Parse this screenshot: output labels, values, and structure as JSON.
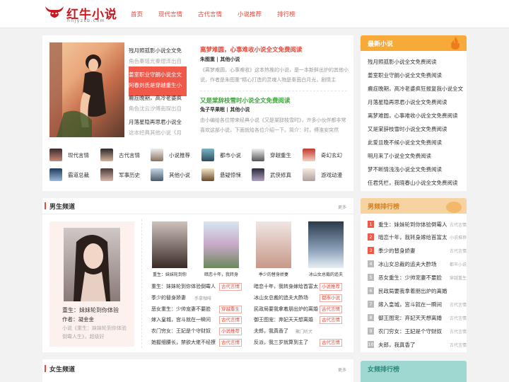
{
  "header": {
    "logo_text": "红牛小说",
    "logo_sub": "hnjyzsb.com",
    "nav": [
      "首页",
      "现代言情",
      "古代言情",
      "小说推荐",
      "排行榜"
    ]
  },
  "slider": {
    "items": [
      {
        "title": "残月照孤影小说全文免",
        "desc": "角色秦瑶光秦煜泽出自"
      },
      {
        "title": "姜室职业守朗小说全文",
        "desc": "阿春刘氏是穿越重生小"
      },
      {
        "title": "癫症晚期，高冷老婆疯",
        "desc": "角色沈云汐傅南琛出自"
      },
      {
        "title": "月落星隐再思君小说全",
        "desc": "这本经典其他小说《月"
      }
    ]
  },
  "featured": [
    {
      "title": "离梦难圆，心事难收小说全文免费阅读",
      "meta": "朱图重 | 其他小说",
      "desc": "《离梦难圆，心事难收》这本热推的小说，是一本新鲜出炉的其他小说，作者是朱图重\"精心打造的灵魂人物是秦茵白月光，剧情主要……"
    },
    {
      "title": "又是棠辞枝雪时小说全文免费阅读",
      "meta": "兔子早果眠 | 其他小说",
      "desc": "由小编给各位带来经典小说《又是棠辞枝雪时》，许多小伙伴都非常喜欢这部小说，下面就给各位介绍一下。简介：时，傅淮安突然起……"
    }
  ],
  "categories": [
    "现代言情",
    "古代言情",
    "小说推荐",
    "都市小说",
    "穿越重生",
    "奇幻玄幻",
    "霸道总裁",
    "军事历史",
    "其他小说",
    "悬疑惊悚",
    "武侠修真",
    "游戏动漫"
  ],
  "latest": {
    "title": "最新小说",
    "items": [
      "残月照孤影小说全文免费阅读",
      "姜室职业守朗小说全文免费阅读",
      "癫症晚期，高冷老婆疯狂报复我小说全文",
      "月落星隐再思君小说全文免费阅读",
      "离梦难圆，心事难收小说全文免费阅读",
      "又是棠辞枝雪时小说全文免费阅读",
      "此爱且晚不候小说全文免费阅读",
      "明月来了小说全文免费阅读",
      "梦不断情浅浅小说全文免费阅读",
      "任君凭栏，我晓春山小说全文免费阅读"
    ]
  },
  "male_channel": {
    "title": "男生频道",
    "more": "更多",
    "main_title": "重生：妹妹轮到你体验",
    "main_author": "作者：凝金金",
    "main_desc": "小说《重生：妹妹轮到你体验倒霉人生》，超级好",
    "books": [
      "重生：妹妹轮到你",
      "暗恋十年，我转身",
      "季少的替身娇妻",
      "冰山女总裁的追夫"
    ],
    "lines": [
      {
        "text": "重生：妹妹轮到你体验倒霉人",
        "tag": "古代言情"
      },
      {
        "text": "暗恋十年，我转身嫁给首富太",
        "tag": "小说推荐"
      },
      {
        "text": "季少的替身娇妻",
        "tag": "手拿咖啡",
        "plain": true
      },
      {
        "text": "冰山女总裁的追夫大酢场",
        "tag": "都市小说"
      },
      {
        "text": "恶女重生：少帅宠妻不要脸",
        "tag": "穿越重生"
      },
      {
        "text": "民政局要我拿着朋出炉的离婚",
        "tag": "古代言情"
      },
      {
        "text": "嫁入皇城，宫斗就在一瞬间",
        "tag": "古代言情"
      },
      {
        "text": "御王图宠：弃妃天天想离婚",
        "tag": "古代言情"
      },
      {
        "text": "农门穷女：王妃是个守财奴",
        "tag": "小说推荐"
      },
      {
        "text": "夫郎，我真香了",
        "tag": "聚门听犬",
        "plain": true
      },
      {
        "text": "她握细腰长，禁欲大佬不经撩",
        "tag": "古代言情"
      },
      {
        "text": "反派，我三岁就算到主了",
        "tag": "古代言情"
      }
    ]
  },
  "male_rank": {
    "title": "男频排行榜",
    "items": [
      {
        "name": "重生：妹妹轮到你体验倒霉人",
        "cat": "古代言情"
      },
      {
        "name": "暗恋十年，我转身嫁给首富太",
        "cat": "小说推荐"
      },
      {
        "name": "季少的替身娇妻",
        "cat": "古代言情"
      },
      {
        "name": "冰山女总裁的追夫大酢场",
        "cat": "都市小说"
      },
      {
        "name": "恶女重生：少帅宠妻不要脸",
        "cat": "穿越重生"
      },
      {
        "name": "民政局要我拿着朋出炉的离婚",
        "cat": ""
      },
      {
        "name": "嫁入皇城，宫斗就在一瞬间",
        "cat": "古代言情"
      },
      {
        "name": "御王图宠：弃妃天天想离婚",
        "cat": "古代言情"
      },
      {
        "name": "农门穷女：王妃是个守财奴",
        "cat": "古代言情"
      },
      {
        "name": "夫郎，我真香了",
        "cat": "古代言情"
      }
    ],
    "numbers": [
      "1",
      "2",
      "3",
      "4",
      "5",
      "6",
      "7",
      "8",
      "9",
      "10"
    ]
  },
  "female_channel": {
    "title": "女生频道",
    "more": "更多"
  },
  "female_rank": {
    "title": "女频排行榜"
  },
  "colors": {
    "accent": "#e5493a",
    "green": "#3ea53a",
    "latest_head": "#f7a93a",
    "male_head": "#f6d3a0",
    "female_head": "#9fd8d0"
  }
}
